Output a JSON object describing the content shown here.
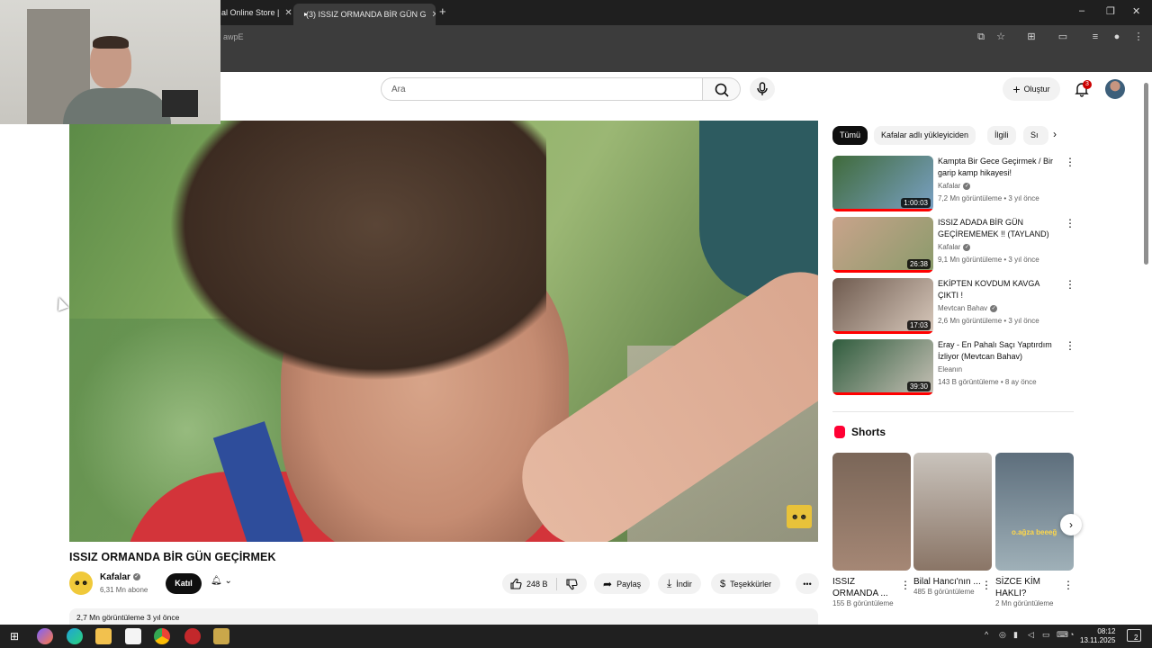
{
  "browser": {
    "tabs": [
      {
        "title": "al Online Store |"
      },
      {
        "title": "(3) ISSIZ ORMANDA BİR GÜN G"
      }
    ],
    "address_text": "awpE"
  },
  "header": {
    "search_placeholder": "Ara",
    "create_label": "Oluştur",
    "notif_count": "3"
  },
  "video": {
    "title": "ISSIZ ORMANDA BİR GÜN GEÇİRMEK",
    "channel": "Kafalar",
    "subscribers": "6,31 Mn abone",
    "join_label": "Katıl",
    "likes": "248 B",
    "share_label": "Paylaş",
    "download_label": "İndir",
    "thanks_label": "Teşekkürler",
    "description_meta": "2,7 Mn görüntüleme  3 yıl önce"
  },
  "chips": [
    "Tümü",
    "Kafalar adlı yükleyiciden",
    "İlgili",
    "Sı"
  ],
  "recommended": [
    {
      "title": "Kampta Bir Gece Geçirmek / Bir garip kamp hikayesi!",
      "channel": "Kafalar",
      "meta": "7,2 Mn görüntüleme • 3 yıl önce",
      "duration": "1:00:03",
      "colors": [
        "#3f6a3a",
        "#7aa1c5"
      ]
    },
    {
      "title": "ISSIZ ADADA BİR GÜN GEÇİREMEMEK !! (TAYLAND)",
      "channel": "Kafalar",
      "meta": "9,1 Mn görüntüleme • 3 yıl önce",
      "duration": "26:38",
      "colors": [
        "#c9a38b",
        "#8a9b6b"
      ]
    },
    {
      "title": "EKİPTEN KOVDUM KAVGA ÇIKTI !",
      "channel": "Mevtcan Bahav",
      "meta": "2,6 Mn görüntüleme • 3 yıl önce",
      "duration": "17:03",
      "colors": [
        "#6e5a4e",
        "#d8c9bc"
      ]
    },
    {
      "title": "Eray - En Pahalı Saçı Yaptırdım İzliyor (Mevtcan Bahav)",
      "channel": "Eleanın",
      "meta": "143 B görüntüleme • 8 ay önce",
      "duration": "39:30",
      "colors": [
        "#2f5c3d",
        "#c7c1b6"
      ]
    }
  ],
  "shorts": {
    "label": "Shorts",
    "items": [
      {
        "title": "ISSIZ ORMANDA ...",
        "views": "155 B görüntüleme",
        "colors": [
          "#7a6658",
          "#a58775"
        ]
      },
      {
        "title": "Bilal Hancı'nın ...",
        "views": "485 B görüntüleme",
        "colors": [
          "#c9c3bc",
          "#8a7566"
        ]
      },
      {
        "title": "SİZCE KİM HAKLI?",
        "views": "2 Mn görüntüleme",
        "colors": [
          "#5d6e7c",
          "#9fb0b8"
        ]
      }
    ],
    "caption_3": "o.ağza beeeğ"
  },
  "taskbar": {
    "time": "08:12",
    "date": "13.11.2025",
    "notifications": "2"
  }
}
